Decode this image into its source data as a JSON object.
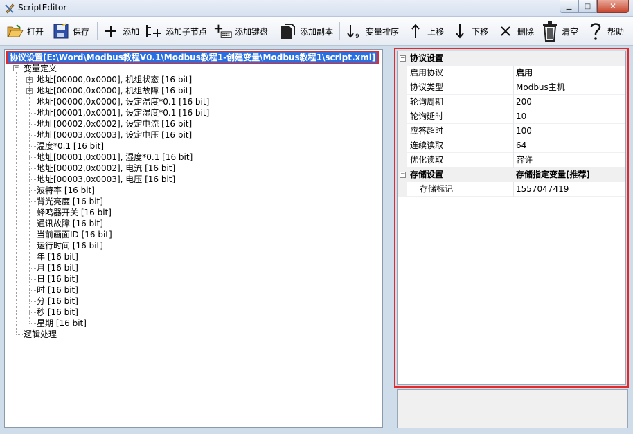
{
  "window": {
    "title": "ScriptEditor"
  },
  "toolbar": {
    "open": "打开",
    "save": "保存",
    "add": "添加",
    "add_child": "添加子节点",
    "add_keyboard": "添加键盘",
    "add_copy": "添加副本",
    "var_sort": "变量排序",
    "move_up": "上移",
    "move_down": "下移",
    "delete": "删除",
    "clear": "清空",
    "help": "帮助"
  },
  "tree": {
    "root": "协议设置[E:\\Word\\Modbus教程V0.1\\Modbus教程1-创建变量\\Modbus教程1\\script.xml]",
    "var_group": "变量定义",
    "items": [
      "地址[00000,0x0000], 机组状态 [16 bit]",
      "地址[00000,0x0000], 机组故障 [16 bit]",
      "地址[00000,0x0000], 设定温度*0.1 [16 bit]",
      "地址[00001,0x0001], 设定湿度*0.1 [16 bit]",
      "地址[00002,0x0002], 设定电流 [16 bit]",
      "地址[00003,0x0003], 设定电压 [16 bit]",
      "温度*0.1 [16 bit]",
      "地址[00001,0x0001], 湿度*0.1 [16 bit]",
      "地址[00002,0x0002], 电流 [16 bit]",
      "地址[00003,0x0003], 电压 [16 bit]",
      "波特率 [16 bit]",
      "背光亮度 [16 bit]",
      "蜂鸣器开关 [16 bit]",
      "通讯故障 [16 bit]",
      "当前画面ID [16 bit]",
      "运行时间 [16 bit]",
      "年 [16 bit]",
      "月 [16 bit]",
      "日 [16 bit]",
      "时 [16 bit]",
      "分 [16 bit]",
      "秒 [16 bit]",
      "星期 [16 bit]"
    ],
    "logic_group": "逻辑处理"
  },
  "props": {
    "cat1": "协议设置",
    "rows1": [
      {
        "name": "启用协议",
        "value": "启用"
      },
      {
        "name": "协议类型",
        "value": "Modbus主机"
      },
      {
        "name": "轮询周期",
        "value": "200"
      },
      {
        "name": "轮询延时",
        "value": "10"
      },
      {
        "name": "应答超时",
        "value": "100"
      },
      {
        "name": "连续读取",
        "value": "64"
      },
      {
        "name": "优化读取",
        "value": "容许"
      }
    ],
    "cat2": "存储设置",
    "cat2_value": "存储指定变量[推荐]",
    "rows2": [
      {
        "name": "存储标记",
        "value": "1557047419"
      }
    ]
  }
}
